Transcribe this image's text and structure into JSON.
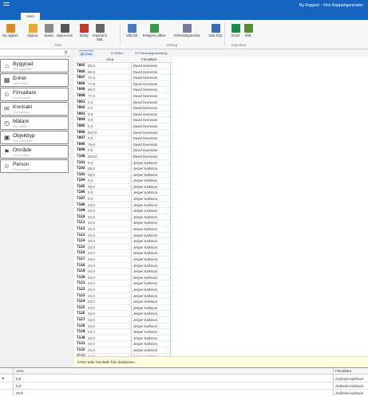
{
  "window": {
    "title": "Ny Rapport - Vinn Rapportgenerator"
  },
  "ribbon": {
    "tab": "Hem",
    "buttons": [
      {
        "label": "Ny rapport",
        "icon": "new-report-icon",
        "color": "#d98b2b"
      },
      {
        "label": "Öppna",
        "icon": "open-folder-icon",
        "color": "#e6a83a"
      },
      {
        "label": "Spara",
        "icon": "save-icon",
        "color": "#8a8a8a"
      },
      {
        "label": "Spara som",
        "icon": "save-as-icon",
        "color": "#555555"
      },
      {
        "label": "Stäng",
        "icon": "close-report-icon",
        "color": "#c0392b"
      },
      {
        "label": "Importera XML",
        "icon": "import-xml-icon",
        "color": "#666666"
      },
      {
        "label": "Välj fält",
        "icon": "choose-fields-icon",
        "color": "#4a7ab8"
      },
      {
        "label": "Redigera villkor",
        "icon": "edit-conditions-icon",
        "color": "#3a9a4a"
      },
      {
        "label": "Förhandsgranska",
        "icon": "preview-icon",
        "color": "#7a7a9a"
      },
      {
        "label": "Visa SQL",
        "icon": "show-sql-icon",
        "color": "#3a6ab8"
      },
      {
        "label": "Excel",
        "icon": "excel-icon",
        "color": "#1f8a4a"
      },
      {
        "label": "XML",
        "icon": "xml-export-icon",
        "color": "#5a8a3a"
      }
    ],
    "groups": [
      "Arkiv",
      "Verktyg",
      "Exportera"
    ]
  },
  "nav": {
    "items": [
      {
        "label": "Byggnad",
        "sub": "Visa byggnader",
        "icon": "building-icon"
      },
      {
        "label": "Enhet",
        "sub": "Visa enheter",
        "icon": "unit-icon"
      },
      {
        "label": "Förvaltare",
        "sub": "Visa förvaltare",
        "icon": "manager-icon"
      },
      {
        "label": "Kontrakt",
        "sub": "Visa kontrakt",
        "icon": "contract-icon"
      },
      {
        "label": "Mätare",
        "sub": "Visa mätare",
        "icon": "meter-icon"
      },
      {
        "label": "Objekttyp",
        "sub": "Visa objekttyper",
        "icon": "object-type-icon"
      },
      {
        "label": "Område",
        "sub": "Visa områden",
        "icon": "area-icon"
      },
      {
        "label": "Person",
        "sub": "Visa personer",
        "icon": "person-icon"
      }
    ]
  },
  "grid": {
    "tabs": [
      "Urval",
      "Villkor",
      "Förhandsgranskning"
    ],
    "headers": {
      "area": "Area",
      "name": "Förvaltare"
    },
    "rows": [
      {
        "id": "7085",
        "area": "69,0",
        "name": "David Svensson"
      },
      {
        "id": "7086",
        "area": "69,0",
        "name": "David Svensson"
      },
      {
        "id": "7087",
        "area": "77,0",
        "name": "David Svensson"
      },
      {
        "id": "7088",
        "area": "77,0",
        "name": "David Svensson"
      },
      {
        "id": "7089",
        "area": "69,0",
        "name": "David Svensson"
      },
      {
        "id": "7090",
        "area": "77,0",
        "name": "David Svensson"
      },
      {
        "id": "7091",
        "area": "0,0",
        "name": "David Svensson"
      },
      {
        "id": "7092",
        "area": "0,0",
        "name": "David Svensson"
      },
      {
        "id": "7093",
        "area": "0,0",
        "name": "David Svensson"
      },
      {
        "id": "7094",
        "area": "9,0",
        "name": "David Svensson"
      },
      {
        "id": "7095",
        "area": "0,0",
        "name": "David Svensson"
      },
      {
        "id": "7096",
        "area": "507,0",
        "name": "David Svensson"
      },
      {
        "id": "7097",
        "area": "0,0",
        "name": "David Svensson"
      },
      {
        "id": "7098",
        "area": "79,0",
        "name": "David Svensson"
      },
      {
        "id": "7099",
        "area": "0,0",
        "name": "David Svensson"
      },
      {
        "id": "7100",
        "area": "283,0",
        "name": "David Svensson"
      },
      {
        "id": "7101",
        "area": "0,0",
        "name": "Jesper Karlsson"
      },
      {
        "id": "7102",
        "area": "58,0",
        "name": "Jesper Karlsson"
      },
      {
        "id": "7103",
        "area": "58,0",
        "name": "Jesper Karlsson"
      },
      {
        "id": "7104",
        "area": "0,0",
        "name": "Jesper Karlsson"
      },
      {
        "id": "7105",
        "area": "58,0",
        "name": "Jesper Karlsson"
      },
      {
        "id": "7106",
        "area": "2,0",
        "name": "Jesper Karlsson"
      },
      {
        "id": "7107",
        "area": "0,0",
        "name": "Jesper Karlsson"
      },
      {
        "id": "7108",
        "area": "34,0",
        "name": "Jesper Karlsson"
      },
      {
        "id": "7109",
        "area": "34,0",
        "name": "Jesper Karlsson"
      },
      {
        "id": "7110",
        "area": "34,0",
        "name": "Jesper Karlsson"
      },
      {
        "id": "7111",
        "area": "34,0",
        "name": "Jesper Karlsson"
      },
      {
        "id": "7112",
        "area": "34,0",
        "name": "Jesper Karlsson"
      },
      {
        "id": "7113",
        "area": "34,0",
        "name": "Jesper Karlsson"
      },
      {
        "id": "7114",
        "area": "34,0",
        "name": "Jesper Karlsson"
      },
      {
        "id": "7115",
        "area": "34,0",
        "name": "Jesper Karlsson"
      },
      {
        "id": "7116",
        "area": "34,0",
        "name": "Jesper Karlsson"
      },
      {
        "id": "7117",
        "area": "34,0",
        "name": "Jesper Karlsson"
      },
      {
        "id": "7118",
        "area": "34,0",
        "name": "Jesper Karlsson"
      },
      {
        "id": "7119",
        "area": "34,0",
        "name": "Jesper Karlsson"
      },
      {
        "id": "7120",
        "area": "34,0",
        "name": "Jesper Karlsson"
      },
      {
        "id": "7121",
        "area": "34,0",
        "name": "Jesper Karlsson"
      },
      {
        "id": "7122",
        "area": "34,0",
        "name": "Jesper Karlsson"
      },
      {
        "id": "7123",
        "area": "34,0",
        "name": "Jesper Karlsson"
      },
      {
        "id": "7124",
        "area": "34,0",
        "name": "Jesper Karlsson"
      },
      {
        "id": "7125",
        "area": "34,0",
        "name": "Jesper Karlsson"
      },
      {
        "id": "7126",
        "area": "34,0",
        "name": "Jesper Karlsson"
      },
      {
        "id": "7127",
        "area": "34,0",
        "name": "Jesper Karlsson"
      },
      {
        "id": "7128",
        "area": "34,0",
        "name": "Jesper Karlsson"
      },
      {
        "id": "7129",
        "area": "34,0",
        "name": "Jesper Karlsson"
      },
      {
        "id": "7130",
        "area": "34,0",
        "name": "Jesper Karlsson"
      },
      {
        "id": "7131",
        "area": "34,0",
        "name": "Jesper Karlsson"
      },
      {
        "id": "7132",
        "area": "34,0",
        "name": "Jesper Karlsson"
      },
      {
        "id": "7133",
        "area": "34,0",
        "name": "Jesper Karlsson"
      },
      {
        "id": "7134",
        "area": "34,0",
        "name": "Jesper Karlsson"
      }
    ]
  },
  "status": {
    "text": "5758 rader hämtade från databasen."
  },
  "bottom": {
    "headers": {
      "area": "Area",
      "name": "Förvaltare"
    },
    "rows": [
      {
        "area": "0,0",
        "name": "Andreas Karlsson",
        "selected": true
      },
      {
        "area": "0,0",
        "name": "Andreas Karlsson",
        "selected": false
      },
      {
        "area": "20,0",
        "name": "Andreas Karlsson",
        "selected": false
      }
    ]
  }
}
